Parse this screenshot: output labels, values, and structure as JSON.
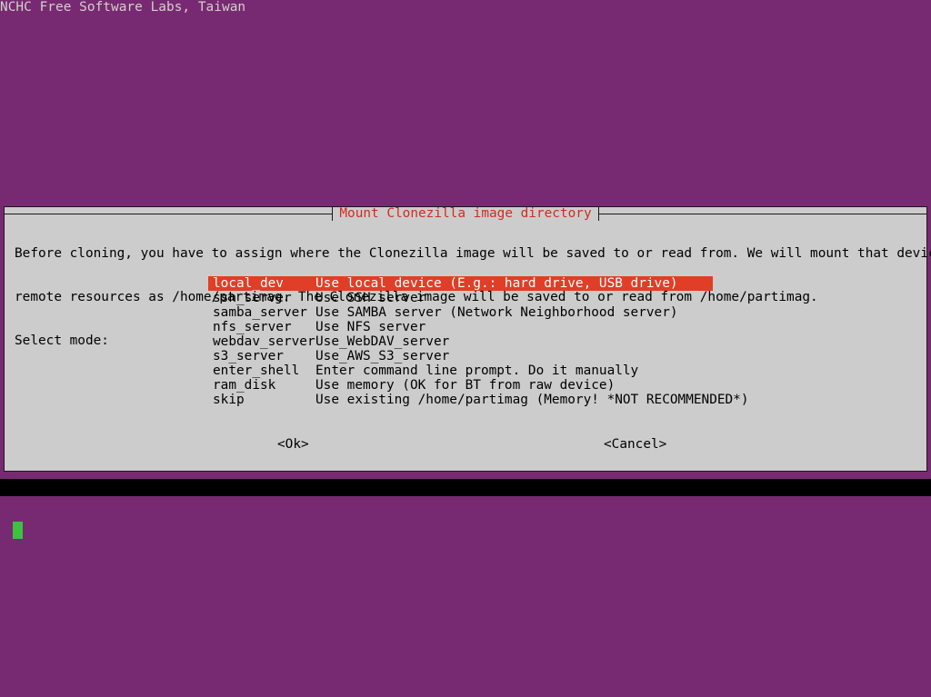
{
  "console": {
    "header_line": "NCHC Free Software Labs, Taiwan"
  },
  "dialog": {
    "title": "Mount Clonezilla image directory",
    "body_lines": [
      "Before cloning, you have to assign where the Clonezilla image will be saved to or read from. We will mount that device or",
      "remote resources as /home/partimag. The Clonezilla image will be saved to or read from /home/partimag.",
      "Select mode:"
    ],
    "menu": [
      {
        "tag": "local_dev",
        "desc": "Use local device (E.g.: hard drive, USB drive)",
        "selected": true
      },
      {
        "tag": "ssh_server",
        "desc": "Use SSH server",
        "selected": false
      },
      {
        "tag": "samba_server",
        "desc": "Use SAMBA server (Network Neighborhood server)",
        "selected": false
      },
      {
        "tag": "nfs_server",
        "desc": "Use NFS server",
        "selected": false
      },
      {
        "tag": "webdav_server",
        "desc": "Use_WebDAV_server",
        "selected": false
      },
      {
        "tag": "s3_server",
        "desc": "Use_AWS_S3_server",
        "selected": false
      },
      {
        "tag": "enter_shell",
        "desc": "Enter command line prompt. Do it manually",
        "selected": false
      },
      {
        "tag": "ram_disk",
        "desc": "Use memory (OK for BT from raw device)",
        "selected": false
      },
      {
        "tag": "skip",
        "desc": "Use existing /home/partimag (Memory! *NOT RECOMMENDED*)",
        "selected": false
      }
    ],
    "buttons": {
      "ok": "<Ok>",
      "cancel": "<Cancel>"
    }
  },
  "colors": {
    "background_purple": "#772a72",
    "dialog_gray": "#cccccc",
    "highlight_red": "#e03e26",
    "title_red": "#d22b1e",
    "cursor_green": "#3ec13e",
    "console_text": "#d4d0c8"
  }
}
